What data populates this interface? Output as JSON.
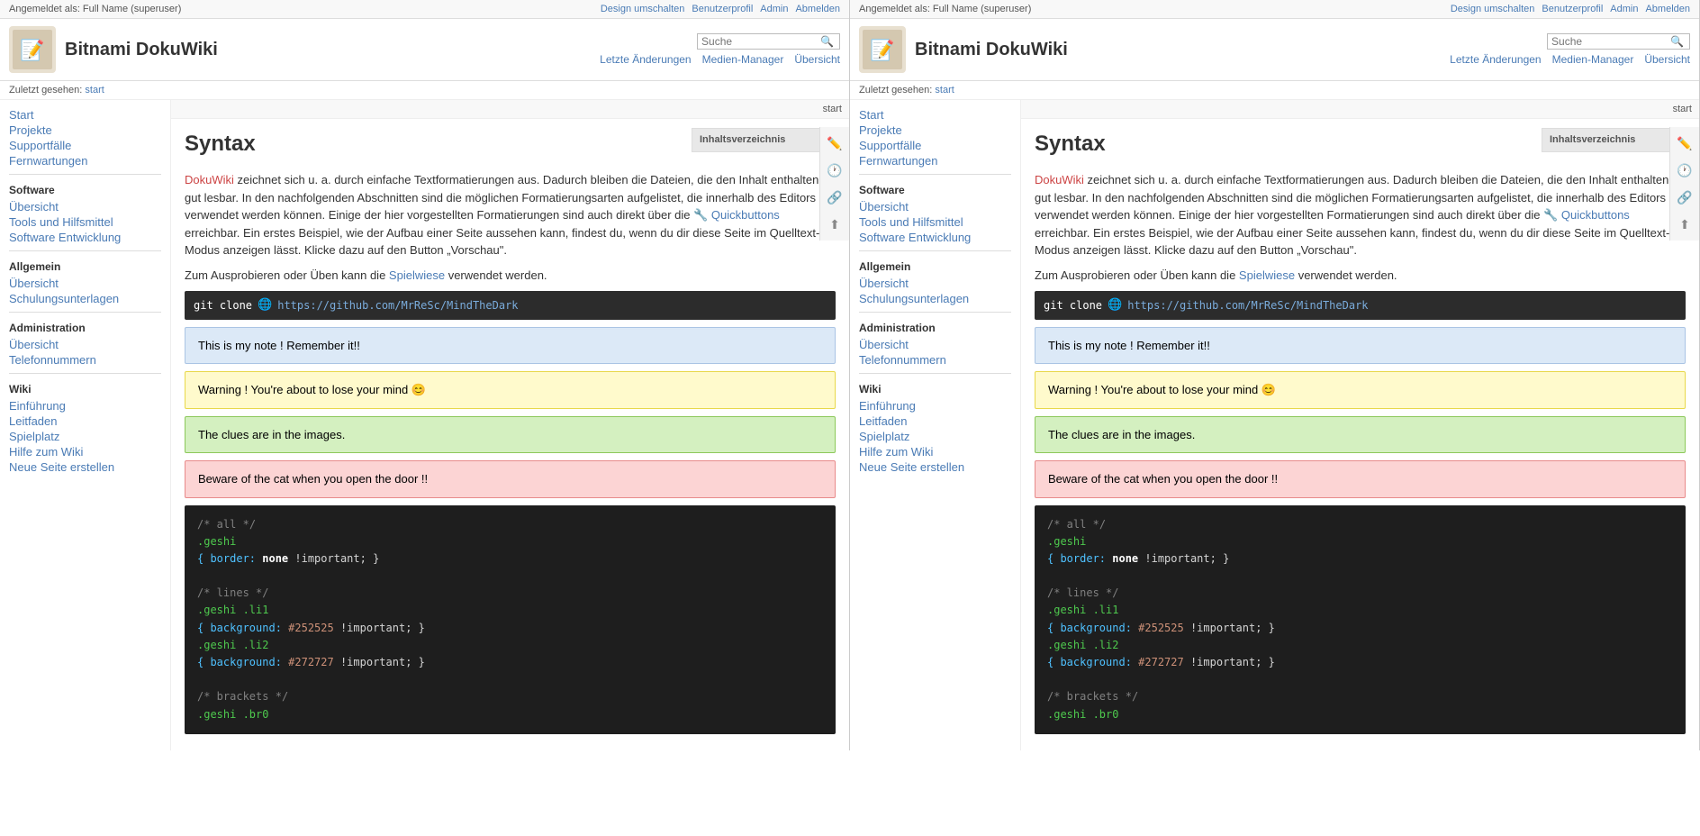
{
  "topbar": {
    "logged_in_text": "Angemeldet als: Full Name (superuser)",
    "design_switch": "Design umschalten",
    "user_profile": "Benutzerprofil",
    "admin": "Admin",
    "logout": "Abmelden",
    "search_placeholder": "Suche"
  },
  "header": {
    "site_title": "Bitnami DokuWiki"
  },
  "nav": {
    "recent_changes": "Letzte Änderungen",
    "media_manager": "Medien-Manager",
    "overview": "Übersicht"
  },
  "breadcrumb": {
    "label": "Zuletzt gesehen:",
    "start": "start"
  },
  "sidebar": {
    "sections": [
      {
        "title": "",
        "links": [
          {
            "label": "Start"
          },
          {
            "label": "Projekte"
          },
          {
            "label": "Supportfälle"
          },
          {
            "label": "Fernwartungen"
          }
        ]
      },
      {
        "title": "Software",
        "links": [
          {
            "label": "Übersicht"
          },
          {
            "label": "Tools und Hilfsmittel"
          },
          {
            "label": "Software Entwicklung"
          }
        ]
      },
      {
        "title": "Allgemein",
        "links": [
          {
            "label": "Übersicht"
          },
          {
            "label": "Schulungsunterlagen"
          }
        ]
      },
      {
        "title": "Administration",
        "links": [
          {
            "label": "Übersicht"
          },
          {
            "label": "Telefonnummern"
          }
        ]
      },
      {
        "title": "Wiki",
        "links": [
          {
            "label": "Einführung"
          },
          {
            "label": "Leitfaden"
          },
          {
            "label": "Spielplatz"
          },
          {
            "label": "Hilfe zum Wiki"
          },
          {
            "label": "Neue Seite erstellen"
          }
        ]
      }
    ]
  },
  "page": {
    "title": "start",
    "toc_label": "Inhaltsverzeichnis",
    "toc_toggle": "▼",
    "article": {
      "title": "Syntax",
      "intro_part1": "DokuWiki",
      "intro_text": " zeichnet sich u. a. durch einfache Textformatierungen aus. Dadurch bleiben die Dateien, die den Inhalt enthalten, gut lesbar. In den nachfolgenden Abschnitten sind die möglichen Formatierungsarten aufgelistet, die innerhalb des Editors verwendet werden können. Einige der hier vorgestellten Formatierungen sind auch direkt über die ",
      "quickbuttons": "Quickbuttons",
      "middle_text": " erreichbar. Ein erstes Beispiel, wie der Aufbau einer Seite aussehen kann, findest du, wenn du dir diese Seite im Quelltext-Modus anzeigen lässt. Klicke dazu auf den Button „Vorschau\".",
      "outro": "Zum Ausprobieren oder Üben kann die ",
      "spielwiese": "Spielwiese",
      "outro2": " verwendet werden.",
      "git_clone_text": "git clone",
      "git_url": "https://github.com/MrReSc/MindTheDark",
      "note_blue": "This is my note ! Remember it!!",
      "note_yellow": "Warning ! You're about to lose your mind 😊",
      "note_green": "The clues are in the images.",
      "note_red": "Beware of the cat when you open the door !!",
      "code_block": {
        "line1_comment": "/* all",
        "line1_pad": "               */",
        "line2": ".geshi",
        "line3_brace": "{ border:",
        "line3_keyword": "none",
        "line3_end": " !important; }",
        "blank": "",
        "line5_comment": "/* lines",
        "line5_pad": "             */",
        "line6": ".geshi .li1",
        "line7_brace": "{ background:",
        "line7_hash": "#252525",
        "line7_end": " !important; }",
        "line8": ".geshi .li2",
        "line9_brace": "{ background:",
        "line9_hash": "#272727",
        "line9_end": " !important; }",
        "blank2": "",
        "line11_comment": "/* brackets",
        "line11_pad": "          */",
        "line12": ".geshi .br0"
      }
    }
  }
}
